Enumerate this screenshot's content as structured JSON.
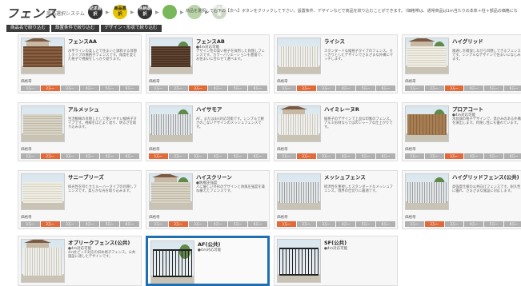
{
  "header": {
    "logo": "フェンス",
    "logo_sub": "商品選択システム",
    "steps": [
      "記述選択",
      "商品選択",
      "色柄選択",
      "",
      "",
      "回答確認"
    ],
    "intro": "商品を選択して右下の【次へ】ボタンをクリックして下さい。設置条件、デザインなどで商品を絞り込むことができます。（価格帯は、通常商品は1ｍ当たりの本体＋柱＋部品の価格になります。①※商品は H1500サイズ"
  },
  "tabs": [
    "商品名で絞り込む",
    "設置条件で絞り込む",
    "デザイン・形状で絞り込む"
  ],
  "price_label": "価格帯",
  "price_levels": [
    "1万〜",
    "2万〜",
    "3万〜",
    "4万〜",
    "5万〜",
    "6万〜"
  ],
  "products": [
    {
      "name": "フェンスAA",
      "tag": "",
      "desc": "水平ラインの美しさで住まいと調和する目隠しタイプの横格子フェンスです。角度を変えた格子で視線をしっかり遮ります。",
      "price_on": 1,
      "art": "brown"
    },
    {
      "name": "フェンスAB",
      "tag": "●4m対応可能",
      "desc": "デザイン性の高い格子を採用した目隠しフェンスです。カラーバリエーションも豊富で、お住まいに合わせて選べます。",
      "price_on": 2,
      "art": "darkbrown"
    },
    {
      "name": "ライシス",
      "tag": "",
      "desc": "スタンダードな縦格子タイプのフェンス。すっきりとしたデザインでさまざまな外構にマッチします。",
      "price_on": 1,
      "art": "white"
    },
    {
      "name": "ハイグリッド",
      "tag": "",
      "desc": "風通しを確保しながら目隠しできるフェンスです。シンプルなデザインで住まいになじみます。",
      "price_on": 2,
      "art": "cream"
    },
    {
      "name": "アルメッシュ",
      "tag": "",
      "desc": "生活動線の目隠しとして使いやすい縦格子タイプです。視線をほどよく遮り、明るさを取り込みます。",
      "price_on": 1,
      "art": "beige"
    },
    {
      "name": "ハイサモア",
      "tag": "",
      "desc": "AF、または4m対応可能です。シンプルで飽きのこないデザインのメッシュフェンスです。",
      "price_on": 0,
      "art": "grey"
    },
    {
      "name": "ハイミレーヌR",
      "tag": "",
      "desc": "縦格子のデザインで上品な印象のフェンス。アルミ形材ならではのシャープな仕上がりです。",
      "price_on": 1,
      "art": "white"
    },
    {
      "name": "プロアコート",
      "tag": "●4m対応可能",
      "desc": "木目調の格子デザインで、温かみのある外構を演出します。目隠し性にも優れています。",
      "price_on": 2,
      "art": "wood"
    },
    {
      "name": "サニーブリーズ",
      "tag": "",
      "desc": "採光性を持たせたルーバータイプの目隠しフェンスです。柔らかな光を取り込みます。",
      "price_on": 1,
      "art": "cream"
    },
    {
      "name": "ハイスクリーン",
      "tag": "●防風圧強度",
      "desc": "人に優しい外形のデザインと防風圧強度を兼ね備えたフェンスです。",
      "price_on": 1,
      "art": "beige"
    },
    {
      "name": "メッシュフェンス",
      "tag": "",
      "desc": "経済性を重視したスタンダードなメッシュフェンス。境界の仕切りに最適です。",
      "price_on": 0,
      "art": "grey"
    },
    {
      "name": "ハイグリッドフェンス(公共)",
      "tag": "",
      "desc": "高強度仕様の公共向けフェンスです。耐久性に優れ、さまざまな施設に対応します。",
      "price_on": 1,
      "art": "grey"
    },
    {
      "name": "オプリークフェンス(公共)",
      "tag": "●4m対応可能",
      "desc": "4m柱ピッチ対応の斜め格子フェンス。公共施設に適したデザインです。",
      "price_on": 0,
      "art": "white"
    },
    {
      "name": "AF(公共)",
      "tag": "●4m対応可能",
      "desc": "",
      "price_on": 0,
      "art": "black"
    },
    {
      "name": "SF(公共)",
      "tag": "●4m対応可能",
      "desc": "",
      "price_on": 0,
      "art": "black"
    }
  ]
}
